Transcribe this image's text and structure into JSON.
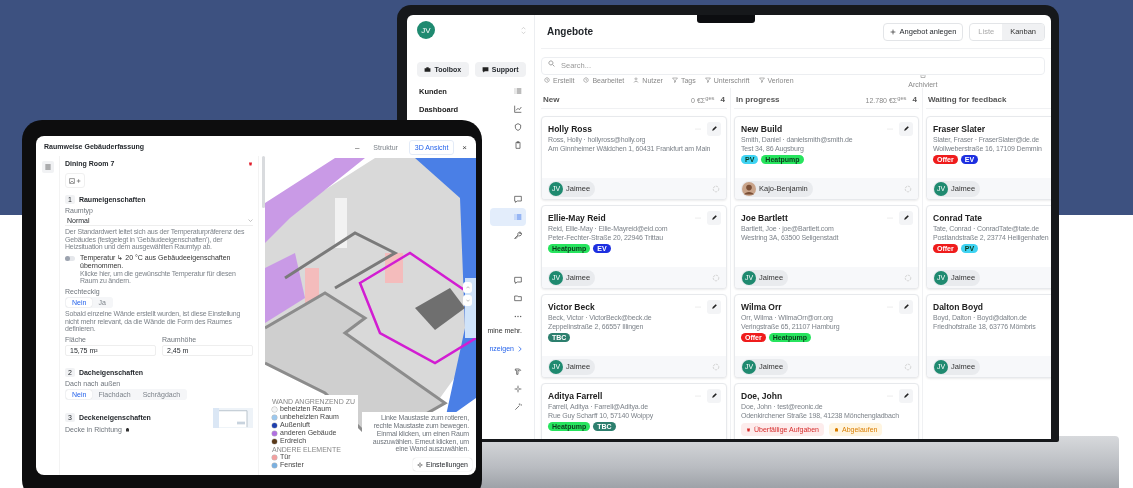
{
  "laptop": {
    "sidebar": {
      "avatar": "JV",
      "buttons": [
        "Toolbox",
        "Support"
      ],
      "groups": [
        {
          "items": [
            {
              "label": "Kunden",
              "selected": false
            },
            {
              "label": "Dashboard",
              "selected": false
            },
            {
              "selected": false
            },
            {
              "selected": false
            }
          ]
        },
        {
          "items": [
            {
              "selected": false
            },
            {
              "selected": true
            },
            {
              "selected": false
            }
          ]
        },
        {
          "items": [
            {
              "selected": false
            },
            {
              "selected": false
            }
          ]
        },
        {
          "items": [
            {
              "selected": false
            },
            {
              "selected": false
            },
            {
              "selected": false
            }
          ]
        }
      ],
      "notice": {
        "text": "mine mehr.",
        "link": "nzeigen"
      }
    },
    "title": "Angebote",
    "create_button": "Angebot anlegen",
    "views": [
      {
        "label": "Liste",
        "selected": false
      },
      {
        "label": "Kanban",
        "selected": true
      }
    ],
    "search": {
      "placeholder": "Search..."
    },
    "filters": [
      {
        "label": "Erstellt",
        "kind": "date"
      },
      {
        "label": "Bearbeitet",
        "kind": "date"
      },
      {
        "label": "Nutzer",
        "kind": "user"
      },
      {
        "label": "Tags",
        "kind": "filter"
      },
      {
        "label": "Unterschrift",
        "kind": "filter"
      },
      {
        "label": "Verloren",
        "kind": "filter"
      },
      {
        "label": "Archiviert",
        "kind": "archive"
      }
    ],
    "columns": [
      {
        "title": "New",
        "total": "0 €Σ$^{ges}$",
        "count": "4",
        "cards": [
          {
            "name": "Holly Ross",
            "contact": "Ross, Holly · hollyross@holly.org",
            "address": "Am Ginnheimer Wäldchen 1, 60431 Frankfurt am Main",
            "user": {
              "kind": "initials",
              "initials": "JV",
              "name": "Jaimee"
            }
          },
          {
            "name": "Ellie-May Reid",
            "contact": "Reid, Ellie-May · Ellie-Mayreid@eid.com",
            "address": "Peter-Fechter-Straße 20, 22946 Trittau",
            "tags": [
              {
                "label": "Heatpump",
                "color": "#27e45e"
              },
              {
                "label": "EV",
                "color": "#1d2fe0"
              }
            ],
            "user": {
              "kind": "initials",
              "initials": "JV",
              "name": "Jaimee"
            }
          },
          {
            "name": "Victor Beck",
            "contact": "Beck, Victor · VictorBeck@beck.de",
            "address": "Zeppelinstraße 2, 66557 Illingen",
            "tags": [
              {
                "label": "TBC",
                "color": "#2d7f6e"
              }
            ],
            "user": {
              "kind": "initials",
              "initials": "JV",
              "name": "Jaimee"
            }
          },
          {
            "name": "Aditya Farrell",
            "contact": "Farrell, Aditya · Farrell@Aditya.de",
            "address": "Rue Guy Scharff 10, 57140 Woippy",
            "tags": [
              {
                "label": "Heatpump",
                "color": "#27e45e"
              },
              {
                "label": "TBC",
                "color": "#2d7f6e"
              }
            ]
          }
        ]
      },
      {
        "title": "In progress",
        "total": "12.780 €Σ$^{ges}$",
        "count": "4",
        "cards": [
          {
            "name": "New Build",
            "contact": "Smith, Daniel · danielsmith@smith.de",
            "address": "Test 34, 86 Augsburg",
            "tags": [
              {
                "label": "PV",
                "color": "#3fd3f2"
              },
              {
                "label": "Heatpump",
                "color": "#27e45e"
              }
            ],
            "user": {
              "name": "Kajo-Benjamin"
            }
          },
          {
            "name": "Joe Bartlett",
            "contact": "Bartlett, Joe · joe@Bartlett.com",
            "address": "Westring 3A, 63500 Seligenstadt",
            "user": {
              "kind": "initials",
              "initials": "JV",
              "name": "Jaimee"
            }
          },
          {
            "name": "Wilma Orr",
            "contact": "Orr, Wilma · WilmaOrr@orr.org",
            "address": "Veringstraße 65, 21107 Hamburg",
            "tags": [
              {
                "label": "Offer",
                "color": "#ef1c1c"
              },
              {
                "label": "Heatpump",
                "color": "#27e45e"
              }
            ],
            "user": {
              "kind": "initials",
              "initials": "JV",
              "name": "Jaimee"
            }
          },
          {
            "name": "Doe, John",
            "contact": "Doe, John · test@reonic.de",
            "address": "Odenkirchener Straße 198, 41238 Mönchengladbach",
            "alerts": [
              {
                "kind": "overdue",
                "label": "Überfällige Aufgaben"
              },
              {
                "kind": "expired",
                "label": "Abgelaufen"
              }
            ]
          }
        ]
      },
      {
        "title": "Waiting for feedback",
        "cards": [
          {
            "name": "Fraser Slater",
            "contact": "Slater, Fraser · FraserSlater@de.de",
            "address": "Wollweberstraße 16, 17109 Demmin",
            "tags": [
              {
                "label": "Offer",
                "color": "#ef1c1c"
              },
              {
                "label": "EV",
                "color": "#1d2fe0"
              }
            ],
            "user": {
              "kind": "initials",
              "initials": "JV",
              "name": "Jaimee"
            }
          },
          {
            "name": "Conrad Tate",
            "contact": "Tate, Conrad · ConradTate@tate.de",
            "address": "Postlandstraße 2, 23774 Heiligenhafen",
            "tags": [
              {
                "label": "Offer",
                "color": "#ef1c1c"
              },
              {
                "label": "PV",
                "color": "#3fd3f2"
              }
            ],
            "user": {
              "kind": "initials",
              "initials": "JV",
              "name": "Jaimee"
            }
          },
          {
            "name": "Dalton Boyd",
            "contact": "Boyd, Dalton · Boyd@dalton.de",
            "address": "Friedhofstraße 18, 63776 Mömbris",
            "user": {
              "kind": "initials",
              "initials": "JV",
              "name": "Jaimee"
            }
          }
        ]
      }
    ]
  },
  "tablet": {
    "title": "Raumweise Gebäuderfassung",
    "room": "Dining Room 7",
    "room_properties": {
      "number": "1",
      "title": "Raumeigenschaften",
      "type_label": "Raumtyp",
      "type": "Normal",
      "type_hint": "Der Standardwert leitet sich aus der Temperaturpräferenz des Gebäudes (festgelegt in 'Gebäudeeigenschaften'), der Heizsituation und dem ausgewählten Raumtyp ab.",
      "temperature": {
        "on": false,
        "text": "Temperatur ↳ 20 °C aus Gebäudeeigenschaften übernommen.",
        "hint": "Klicke hier, um die gewünschte Temperatur für diesen Raum zu ändern."
      },
      "rectangular": {
        "label": "Rechteckig",
        "options": [
          {
            "label": "Nein",
            "selected": true
          },
          {
            "label": "Ja",
            "selected": false
          }
        ],
        "hint": "Sobald einzelne Wände erstellt wurden, ist diese Einstellung nicht mehr relevant, da die Wände die Form des Raumes definieren."
      },
      "area": {
        "label": "Fläche",
        "value": "15,75 m²"
      },
      "height": {
        "label": "Raumhöhe",
        "value": "2,45 m"
      }
    },
    "roof": {
      "number": "2",
      "title": "Dacheigenschaften",
      "label": "Dach nach außen",
      "options": [
        {
          "label": "Nein",
          "selected": true
        },
        {
          "label": "Flachdach",
          "selected": false
        },
        {
          "label": "Schrägdach",
          "selected": false
        }
      ]
    },
    "ceiling": {
      "number": "3",
      "title": "Deckeneigenschaften",
      "label": "Decke in Richtung"
    },
    "view": {
      "minimize": "–",
      "tabs": [
        {
          "label": "Struktur",
          "selected": false
        },
        {
          "label": "3D Ansicht",
          "selected": true
        }
      ],
      "close": "×"
    },
    "legend": {
      "wall_heading": "WAND ANGRENZEND ZU",
      "walls": [
        {
          "label": "beheizten Raum",
          "color": "#f4f4f4"
        },
        {
          "label": "unbeheizten Raum",
          "color": "#9cc8ee"
        },
        {
          "label": "Außenluft",
          "color": "#1f3fae"
        },
        {
          "label": "anderen Gebäude",
          "color": "#b070e0"
        },
        {
          "label": "Erdreich",
          "color": "#5a3a1a"
        }
      ],
      "elements_heading": "ANDERE ELEMENTE",
      "elements": [
        {
          "label": "Tür",
          "color": "#f2a0a0"
        },
        {
          "label": "Fenster",
          "color": "#7ab0e0"
        }
      ]
    },
    "hint": [
      "Linke Maustaste zum rotieren, rechte Maustaste zum bewegen.",
      "Einmal klicken, um einen Raum auszuwählen. Erneut klicken, um eine Wand auszuwählen."
    ],
    "settings_button": "Einstellungen"
  }
}
